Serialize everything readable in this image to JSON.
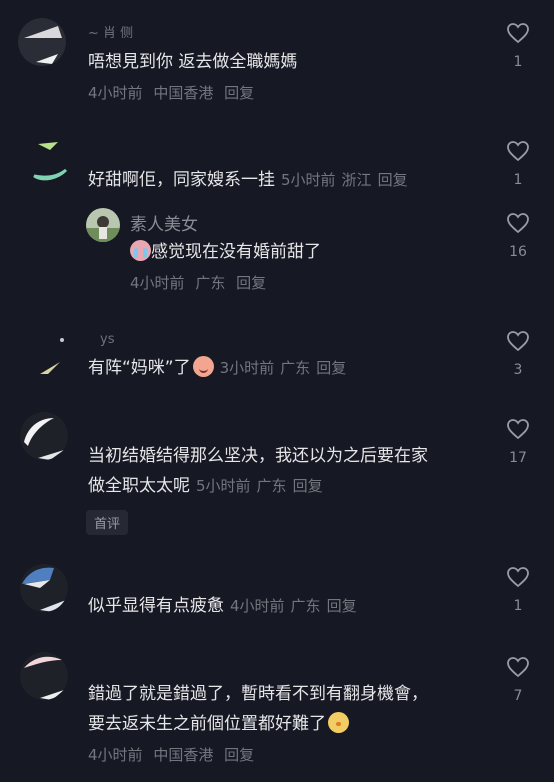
{
  "heart_icon": "heart-outline-icon",
  "comments": [
    {
      "username": "~ 肖 侧",
      "text": "唔想見到你 返去做全職媽媽",
      "time": "4小时前",
      "location": "中国香港",
      "reply": "回复",
      "likes": "1"
    },
    {
      "username": "",
      "text": "好甜啊佢，同家嫂系一挂",
      "time": "5小时前",
      "location": "浙江",
      "reply": "回复",
      "likes": "1",
      "sub_reply": {
        "username": "素人美女",
        "text": "感觉现在没有婚前甜了",
        "time": "4小时前",
        "location": "广东",
        "reply": "回复",
        "likes": "16"
      }
    },
    {
      "username": "ys",
      "text": "有阵“妈咪”了",
      "time": "3小时前",
      "location": "广东",
      "reply": "回复",
      "likes": "3"
    },
    {
      "username": "",
      "text_line1": "当初结婚结得那么坚决，我还以为之后要在家",
      "text_line2": "做全职太太呢",
      "time": "5小时前",
      "location": "广东",
      "reply": "回复",
      "badge": "首评",
      "likes": "17"
    },
    {
      "username": "",
      "text": "似乎显得有点疲惫",
      "time": "4小时前",
      "location": "广东",
      "reply": "回复",
      "likes": "1"
    },
    {
      "username": "",
      "text_line1": "錯過了就是錯過了，暫時看不到有翻身機會，",
      "text_line2": "要去返未生之前個位置都好難了",
      "time": "4小时前",
      "location": "中国香港",
      "reply": "回复",
      "likes": "7"
    }
  ]
}
